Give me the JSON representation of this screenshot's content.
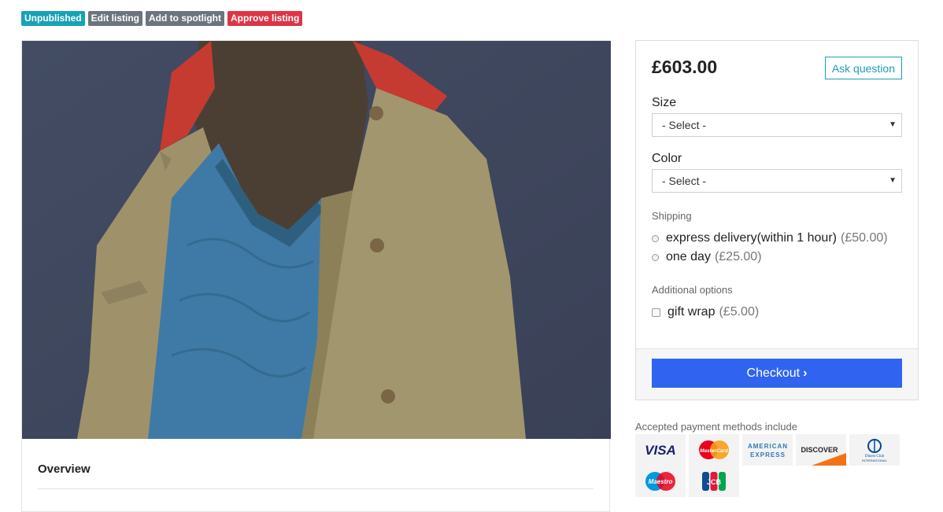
{
  "admin_badges": {
    "unpublished": "Unpublished",
    "edit": "Edit listing",
    "spotlight": "Add to spotlight",
    "approve": "Approve listing"
  },
  "product": {
    "image_icon": "coat-photo",
    "overview_title": "Overview"
  },
  "purchase": {
    "price": "£603.00",
    "ask_question": "Ask question",
    "size": {
      "label": "Size",
      "selected": "- Select -"
    },
    "color": {
      "label": "Color",
      "selected": "- Select -"
    },
    "shipping": {
      "label": "Shipping",
      "options": [
        {
          "label": "express delivery(within 1 hour)",
          "price": "(£50.00)"
        },
        {
          "label": "one day",
          "price": "(£25.00)"
        }
      ]
    },
    "additional": {
      "label": "Additional options",
      "options": [
        {
          "label": "gift wrap",
          "price": "(£5.00)"
        }
      ]
    },
    "checkout": "Checkout"
  },
  "payment": {
    "label": "Accepted payment methods include",
    "methods": [
      {
        "name": "visa-icon",
        "text": "VISA",
        "color": "#1a1f71"
      },
      {
        "name": "mastercard-icon",
        "text": "MasterCard",
        "color": "#eb001b"
      },
      {
        "name": "amex-icon",
        "text": "AMERICAN EXPRESS",
        "color": "#2e77bb"
      },
      {
        "name": "discover-icon",
        "text": "DISCOVER",
        "color": "#f47216"
      },
      {
        "name": "diners-club-icon",
        "text": "Diners Club INTERNATIONAL",
        "color": "#004a97"
      },
      {
        "name": "maestro-icon",
        "text": "Maestro",
        "color": "#0099df"
      },
      {
        "name": "jcb-icon",
        "text": "JCB",
        "color": "#0e4c96"
      }
    ]
  },
  "colors": {
    "accent": "#17a2b8",
    "approve": "#dc3545",
    "checkout": "#3064f0"
  }
}
